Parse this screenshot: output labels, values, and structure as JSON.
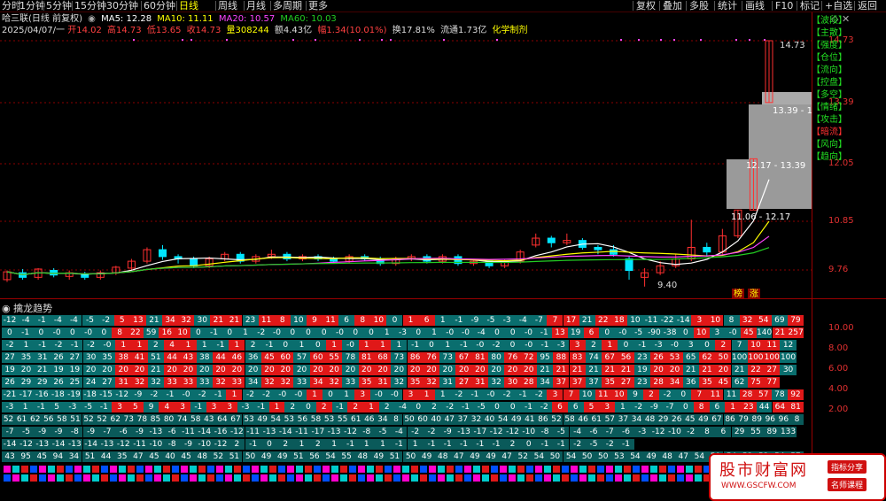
{
  "toolbar": {
    "left": [
      "分时",
      "1分钟",
      "5分钟",
      "15分钟",
      "30分钟",
      "60分钟",
      "日线",
      "周线",
      "月线",
      "多周期",
      "更多"
    ],
    "active": "日线",
    "right": [
      "复权",
      "叠加",
      "多股",
      "统计",
      "画线",
      "F10",
      "标记",
      "+自选",
      "返回"
    ]
  },
  "info": {
    "title": "哈三联(日线 前复权)",
    "ma5": "MA5: 12.28",
    "ma10": "MA10: 11.11",
    "ma20": "MA20: 10.57",
    "ma60": "MA60: 10.03",
    "date": "2025/04/07/一",
    "open": "开14.02",
    "high": "高14.73",
    "low": "低13.65",
    "close": "收14.73",
    "volume": "量308244",
    "amount": "额4.43亿",
    "change": "幅1.34(10.01%)",
    "turnover": "换17.81%",
    "float": "流通1.73亿",
    "concept": "化学制剂"
  },
  "colors": {
    "up": "#ff3030",
    "down": "#00e5ff",
    "ma5": "#ffffff",
    "ma10": "#ffff00",
    "ma20": "#ff44ff",
    "ma60": "#22cc22",
    "grid": "#8b0000"
  },
  "yaxis": {
    "main": [
      "14.73",
      "13.39",
      "12.05",
      "10.85",
      "9.76"
    ],
    "indicator": [
      "10.00",
      "8.00",
      "6.00",
      "4.00",
      "2.00"
    ]
  },
  "annotations": {
    "high": "14.73",
    "low": "9.40",
    "zone1": "13.39 - 13.65",
    "zone2": "12.17 - 13.39",
    "zone3": "11.06 - 12.17",
    "tags": [
      "榜",
      "涨"
    ]
  },
  "indicator": {
    "title": "擒龙趋势",
    "rows": [
      {
        "label": "【波段】",
        "values": [
          "-12",
          "-4",
          "-1",
          "-4",
          "-4",
          "-5",
          "-2",
          "5",
          "13",
          "21",
          "34",
          "32",
          "30",
          "21",
          "21",
          "23",
          "11",
          "8",
          "10",
          "9",
          "11",
          "6",
          "8",
          "10",
          "0",
          "1",
          "6",
          "1",
          "-1",
          "-9",
          "-5",
          "-3",
          "-4",
          "-7",
          "7",
          "17",
          "21",
          "22",
          "18",
          "10",
          "-11",
          "-22",
          "-14",
          "3",
          "10",
          "8",
          "32",
          "54",
          "69",
          "79"
        ]
      },
      {
        "label": "【主散】",
        "values": [
          "0",
          "-1",
          "0",
          "-0",
          "0",
          "-0",
          "0",
          "8",
          "22",
          "59",
          "16",
          "10",
          "0",
          "-1",
          "0",
          "1",
          "-2",
          "-0",
          "0",
          "0",
          "0",
          "-0",
          "0",
          "0",
          "1",
          "-3",
          "0",
          "1",
          "-0",
          "-0",
          "-4",
          "0",
          "0",
          "-0",
          "-1",
          "13",
          "19",
          "6",
          "0",
          "-0",
          "-5",
          "-90",
          "-38",
          "0",
          "10",
          "3",
          "-0",
          "45",
          "140",
          "21",
          "257"
        ]
      },
      {
        "label": "【强度】",
        "values": [
          "-2",
          "1",
          "-1",
          "-2",
          "-1",
          "-2",
          "-0",
          "1",
          "1",
          "2",
          "4",
          "1",
          "1",
          "-1",
          "1",
          "2",
          "-1",
          "0",
          "1",
          "0",
          "1",
          "-0",
          "1",
          "1",
          "1",
          "-1",
          "0",
          "1",
          "-1",
          "-0",
          "-2",
          "0",
          "-0",
          "-1",
          "-3",
          "3",
          "2",
          "1",
          "0",
          "-1",
          "-3",
          "-0",
          "3",
          "0",
          "2",
          "7",
          "10",
          "11",
          "12"
        ]
      },
      {
        "label": "【仓位】",
        "values": [
          "27",
          "35",
          "31",
          "26",
          "27",
          "30",
          "35",
          "38",
          "41",
          "51",
          "44",
          "43",
          "38",
          "44",
          "46",
          "36",
          "45",
          "60",
          "57",
          "60",
          "55",
          "78",
          "81",
          "68",
          "73",
          "86",
          "76",
          "73",
          "67",
          "81",
          "80",
          "76",
          "72",
          "95",
          "88",
          "83",
          "74",
          "67",
          "56",
          "23",
          "26",
          "53",
          "65",
          "62",
          "50",
          "100",
          "100",
          "100",
          "100"
        ]
      },
      {
        "label": "【流向】",
        "values": [
          "19",
          "20",
          "21",
          "19",
          "19",
          "20",
          "20",
          "20",
          "20",
          "21",
          "20",
          "20",
          "20",
          "20",
          "20",
          "20",
          "20",
          "20",
          "20",
          "20",
          "20",
          "20",
          "20",
          "20",
          "20",
          "20",
          "20",
          "20",
          "20",
          "20",
          "20",
          "20",
          "20",
          "21",
          "21",
          "21",
          "21",
          "21",
          "21",
          "19",
          "20",
          "20",
          "21",
          "21",
          "20",
          "21",
          "22",
          "27",
          "30"
        ]
      },
      {
        "label": "【控盘】",
        "values": [
          "26",
          "29",
          "29",
          "26",
          "25",
          "24",
          "27",
          "31",
          "32",
          "32",
          "33",
          "33",
          "33",
          "32",
          "33",
          "34",
          "32",
          "32",
          "33",
          "34",
          "32",
          "33",
          "35",
          "31",
          "32",
          "35",
          "32",
          "31",
          "27",
          "31",
          "32",
          "30",
          "28",
          "34",
          "37",
          "37",
          "37",
          "35",
          "27",
          "23",
          "28",
          "34",
          "36",
          "35",
          "45",
          "62",
          "75",
          "77"
        ]
      },
      {
        "label": "【多空】",
        "values": [
          "-21",
          "-17",
          "-16",
          "-18",
          "-19",
          "-18",
          "-15",
          "-12",
          "-9",
          "-2",
          "-1",
          "-0",
          "-2",
          "-1",
          "1",
          "-2",
          "-2",
          "-0",
          "-0",
          "1",
          "0",
          "1",
          "3",
          "-0",
          "-0",
          "3",
          "1",
          "1",
          "-2",
          "-1",
          "-0",
          "-2",
          "-1",
          "-2",
          "3",
          "7",
          "10",
          "11",
          "10",
          "9",
          "2",
          "-2",
          "0",
          "7",
          "11",
          "11",
          "28",
          "57",
          "78",
          "92"
        ]
      },
      {
        "label": "【情绪】",
        "values": [
          "-3",
          "1",
          "-1",
          "5",
          "-3",
          "-5",
          "-1",
          "3",
          "5",
          "9",
          "4",
          "3",
          "-1",
          "3",
          "3",
          "-3",
          "-1",
          "1",
          "2",
          "0",
          "2",
          "-1",
          "2",
          "1",
          "2",
          "-4",
          "0",
          "2",
          "-2",
          "-1",
          "-5",
          "0",
          "0",
          "-1",
          "-2",
          "6",
          "6",
          "5",
          "3",
          "1",
          "-2",
          "-9",
          "-7",
          "0",
          "8",
          "6",
          "1",
          "23",
          "44",
          "64",
          "81"
        ]
      },
      {
        "label": "【攻击】",
        "values": [
          "52",
          "61",
          "62",
          "56",
          "58",
          "51",
          "52",
          "52",
          "62",
          "73",
          "78",
          "85",
          "80",
          "74",
          "58",
          "43",
          "64",
          "67",
          "53",
          "49",
          "54",
          "53",
          "56",
          "58",
          "53",
          "55",
          "61",
          "46",
          "34",
          "8",
          "50",
          "60",
          "40",
          "47",
          "37",
          "32",
          "40",
          "54",
          "49",
          "41",
          "86",
          "52",
          "58",
          "46",
          "61",
          "57",
          "37",
          "34",
          "48",
          "29",
          "26",
          "45",
          "49",
          "67",
          "86",
          "79",
          "89",
          "96",
          "96",
          "8"
        ]
      },
      {
        "label": "【暗流】",
        "values": [
          "-7",
          "-5",
          "-9",
          "-9",
          "-8",
          "-9",
          "-7",
          "-6",
          "-9",
          "-13",
          "-6",
          "-11",
          "-14",
          "-16",
          "-12",
          "-11",
          "-13",
          "-14",
          "-11",
          "-17",
          "-13",
          "-12",
          "-8",
          "-5",
          "-4",
          "-2",
          "-2",
          "-9",
          "-13",
          "-17",
          "-12",
          "-12",
          "-10",
          "-8",
          "-5",
          "-4",
          "-6",
          "-7",
          "-6",
          "-3",
          "-12",
          "-10",
          "-2",
          "8",
          "6",
          "29",
          "55",
          "89",
          "133"
        ]
      },
      {
        "label": "【风向】",
        "values": [
          "-14",
          "-12",
          "-13",
          "-14",
          "-13",
          "-14",
          "-13",
          "-12",
          "-11",
          "-10",
          "-8",
          "-9",
          "-10",
          "-12",
          "2",
          "-1",
          "0",
          "2",
          "1",
          "2",
          "1",
          "-1",
          "1",
          "1",
          "-1",
          "1",
          "-1",
          "-1",
          "-1",
          "-1",
          "-1",
          "2",
          "0",
          "-1",
          "-1",
          "-2",
          "-5",
          "-2",
          "-1"
        ]
      },
      {
        "label": "【趋向】",
        "values": [
          "43",
          "95",
          "45",
          "94",
          "34",
          "51",
          "44",
          "35",
          "47",
          "45",
          "40",
          "45",
          "48",
          "52",
          "51",
          "50",
          "49",
          "49",
          "51",
          "56",
          "54",
          "55",
          "48",
          "49",
          "51",
          "50",
          "49",
          "48",
          "47",
          "49",
          "49",
          "47",
          "52",
          "54",
          "50",
          "54",
          "50",
          "50",
          "53",
          "54",
          "49",
          "48",
          "47",
          "54",
          "50",
          "54",
          "53",
          "52",
          "54",
          "57"
        ]
      }
    ]
  },
  "watermark": {
    "title": "股市财富网",
    "url": "WWW.GSCFW.COM",
    "tag1": "指标分享",
    "tag2": "名师课程"
  }
}
